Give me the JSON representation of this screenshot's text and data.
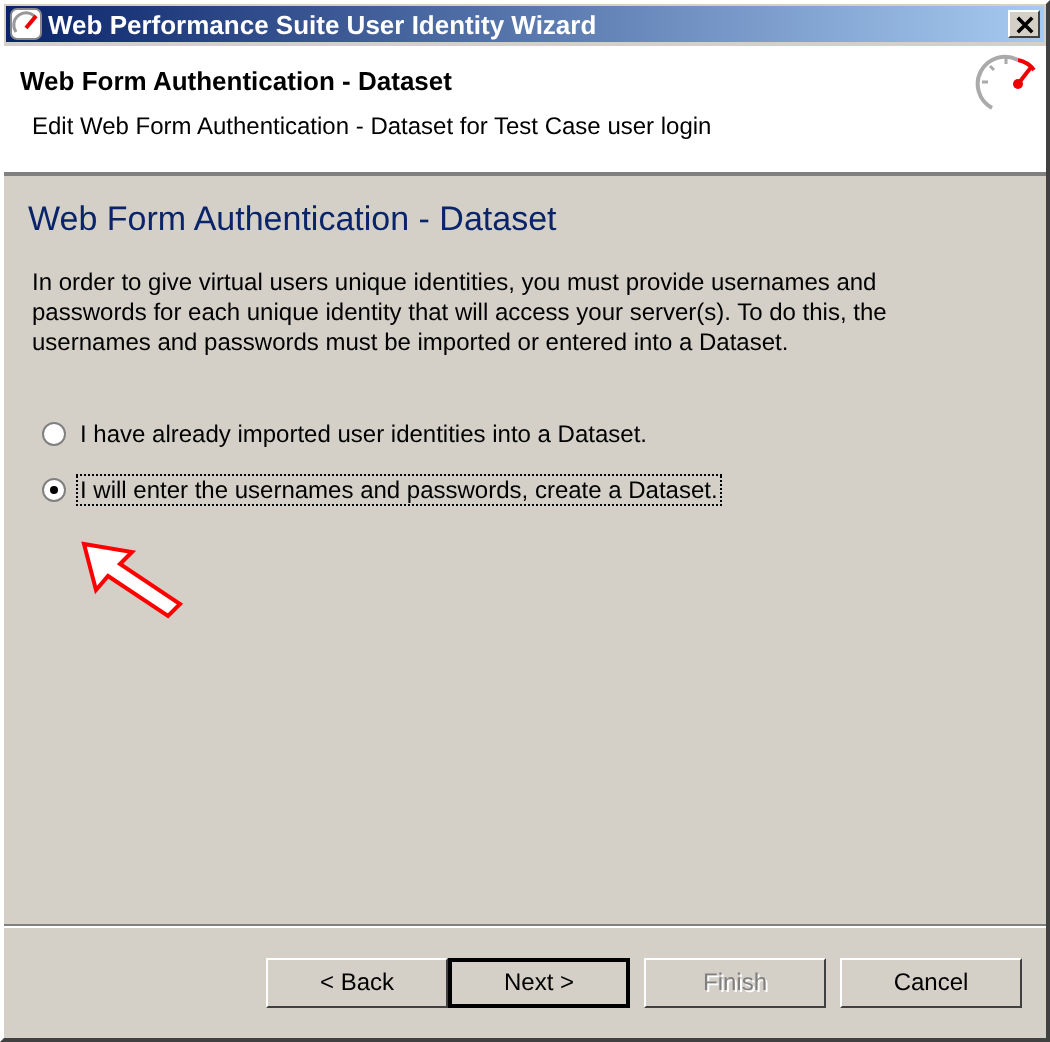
{
  "window": {
    "title": "Web Performance Suite User Identity Wizard"
  },
  "header": {
    "title": "Web Form Authentication - Dataset",
    "subtitle": "Edit Web Form Authentication - Dataset for Test Case user login"
  },
  "page": {
    "heading": "Web Form Authentication - Dataset",
    "description": "In order to give virtual users unique identities, you must provide usernames and passwords for each unique identity that will access your server(s).  To do this, the usernames and passwords must be imported or entered into a Dataset."
  },
  "options": [
    {
      "label": "I have already imported user identities into a Dataset.",
      "selected": false
    },
    {
      "label": "I will enter the usernames and passwords, create a Dataset.",
      "selected": true
    }
  ],
  "buttons": [
    {
      "label": "< Back",
      "disabled": false,
      "default": false
    },
    {
      "label": "Next >",
      "disabled": false,
      "default": true
    },
    {
      "label": "Finish",
      "disabled": true,
      "default": false
    },
    {
      "label": "Cancel",
      "disabled": false,
      "default": false
    }
  ]
}
